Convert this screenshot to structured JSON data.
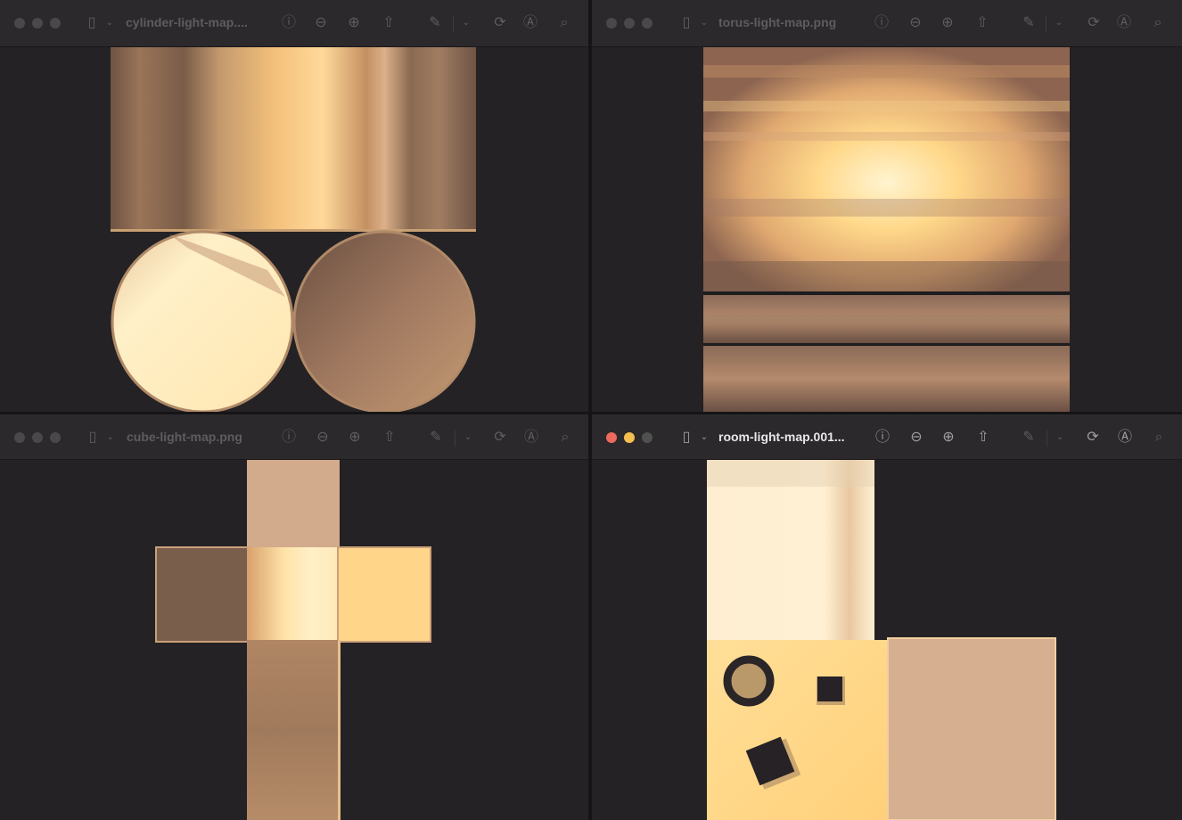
{
  "windows": [
    {
      "id": "cylinder",
      "title": "cylinder-light-map....",
      "active": false
    },
    {
      "id": "torus",
      "title": "torus-light-map.png",
      "active": false
    },
    {
      "id": "cube",
      "title": "cube-light-map.png",
      "active": false
    },
    {
      "id": "room",
      "title": "room-light-map.001...",
      "active": true
    }
  ],
  "toolbar_icons": [
    "sidebar-icon",
    "chevron-down-icon",
    "info-icon",
    "zoom-out-icon",
    "zoom-in-icon",
    "share-icon",
    "markup-pen-icon",
    "chevron-down-icon",
    "rotate-icon",
    "accessibility-icon",
    "search-icon"
  ],
  "colors": {
    "background": "#242224",
    "toolbar": "#2b292b",
    "close": "#ed6a5e",
    "minimize": "#f4bf4f",
    "highlight": "#fff0c8",
    "warm": "#ffd27a",
    "shadow": "#6e5444"
  }
}
